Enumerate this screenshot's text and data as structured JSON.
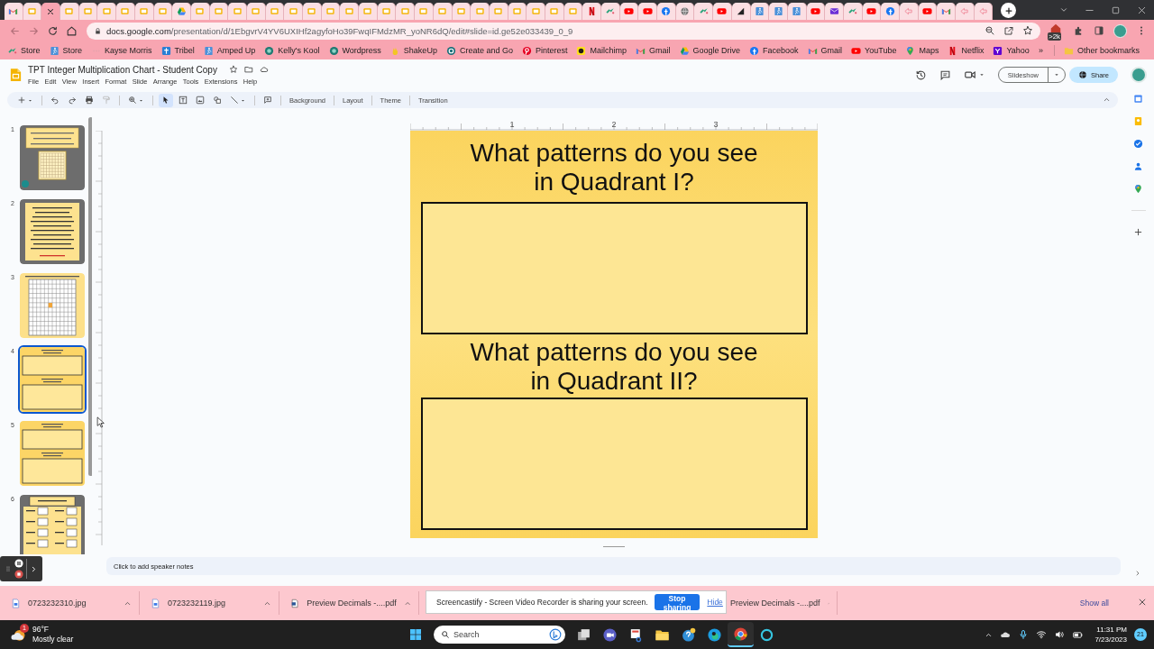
{
  "browser": {
    "tabs": [
      {
        "kind": "gmail",
        "selected": false
      },
      {
        "kind": "slides",
        "selected": false
      },
      {
        "selected": true
      },
      {
        "kind": "slides",
        "selected": false
      },
      {
        "kind": "slides",
        "selected": false
      },
      {
        "kind": "slides",
        "selected": false
      },
      {
        "kind": "slides",
        "selected": false
      },
      {
        "kind": "slides",
        "selected": false
      },
      {
        "kind": "slides",
        "selected": false
      },
      {
        "kind": "drive",
        "selected": false
      },
      {
        "kind": "slides",
        "selected": false
      },
      {
        "kind": "slides",
        "selected": false
      },
      {
        "kind": "slides",
        "selected": false
      },
      {
        "kind": "slides",
        "selected": false
      },
      {
        "kind": "slides",
        "selected": false
      },
      {
        "kind": "slides",
        "selected": false
      },
      {
        "kind": "slides",
        "selected": false
      },
      {
        "kind": "slides",
        "selected": false
      },
      {
        "kind": "slides",
        "selected": false
      },
      {
        "kind": "slides",
        "selected": false
      },
      {
        "kind": "slides",
        "selected": false
      },
      {
        "kind": "slides",
        "selected": false
      },
      {
        "kind": "slides",
        "selected": false
      },
      {
        "kind": "slides",
        "selected": false
      },
      {
        "kind": "slides",
        "selected": false
      },
      {
        "kind": "slides",
        "selected": false
      },
      {
        "kind": "slides",
        "selected": false
      },
      {
        "kind": "slides",
        "selected": false
      },
      {
        "kind": "slides",
        "selected": false
      },
      {
        "kind": "slides",
        "selected": false
      },
      {
        "kind": "slides",
        "selected": false
      },
      {
        "kind": "netflix",
        "selected": false
      },
      {
        "kind": "tribel",
        "selected": false
      },
      {
        "kind": "youtube",
        "selected": false
      },
      {
        "kind": "youtube",
        "selected": false
      },
      {
        "kind": "facebook",
        "selected": false
      },
      {
        "kind": "globe",
        "selected": false
      },
      {
        "kind": "tribel",
        "selected": false
      },
      {
        "kind": "youtube",
        "selected": false
      },
      {
        "kind": "bigcommerce",
        "selected": false
      },
      {
        "kind": "amped",
        "selected": false
      },
      {
        "kind": "amped",
        "selected": false
      },
      {
        "kind": "amped",
        "selected": false
      },
      {
        "kind": "youtube",
        "selected": false
      },
      {
        "kind": "mail",
        "selected": false
      },
      {
        "kind": "tribel",
        "selected": false
      },
      {
        "kind": "youtube",
        "selected": false
      },
      {
        "kind": "facebook",
        "selected": false
      },
      {
        "kind": "cast",
        "selected": false
      },
      {
        "kind": "youtube",
        "selected": false
      },
      {
        "kind": "gmail",
        "selected": false
      },
      {
        "kind": "cast",
        "selected": false
      },
      {
        "kind": "cast",
        "selected": false
      }
    ],
    "url": {
      "host": "docs.google.com",
      "path": "/presentation/d/1EbgvrV4YV6UXIHf2agyfoHo39FwqIFMdzMR_yoNR6dQ/edit#slide=id.ge52e033439_0_9"
    },
    "extension_badge": ">2k",
    "bookmarks": [
      {
        "kind": "tribel",
        "label": "Store"
      },
      {
        "kind": "amped",
        "label": "Store"
      },
      {
        "kind": "blank",
        "label": "Kayse Morris"
      },
      {
        "kind": "cross",
        "label": "Tribel"
      },
      {
        "kind": "amped",
        "label": "Amped Up"
      },
      {
        "kind": "kool",
        "label": "Kelly's Kool"
      },
      {
        "kind": "kool",
        "label": "Wordpress"
      },
      {
        "kind": "hand",
        "label": "ShakeUp"
      },
      {
        "kind": "ring",
        "label": "Create and Go"
      },
      {
        "kind": "pinterest",
        "label": "Pinterest"
      },
      {
        "kind": "mailchimp",
        "label": "Mailchimp"
      },
      {
        "kind": "gmail",
        "label": "Gmail"
      },
      {
        "kind": "drive",
        "label": "Google Drive"
      },
      {
        "kind": "facebook",
        "label": "Facebook"
      },
      {
        "kind": "gmail",
        "label": "Gmail"
      },
      {
        "kind": "youtube",
        "label": "YouTube"
      },
      {
        "kind": "maps",
        "label": "Maps"
      },
      {
        "kind": "netflix",
        "label": "Netflix"
      },
      {
        "kind": "yahoo",
        "label": "Yahoo"
      }
    ],
    "more_bookmarks": "»",
    "other_bookmarks": "Other bookmarks"
  },
  "docs": {
    "title": "TPT Integer Multiplication Chart - Student Copy",
    "menus": [
      "File",
      "Edit",
      "View",
      "Insert",
      "Format",
      "Slide",
      "Arrange",
      "Tools",
      "Extensions",
      "Help"
    ],
    "slideshow": "Slideshow",
    "share": "Share",
    "tools": [
      {
        "kind": "new",
        "selected": false
      },
      {
        "kind": "undo",
        "selected": false
      },
      {
        "kind": "redo",
        "selected": false
      },
      {
        "kind": "print",
        "selected": false
      },
      {
        "kind": "paint-format",
        "selected": false
      },
      {
        "kind": "zoom",
        "selected": false
      },
      {
        "kind": "select",
        "selected": true
      },
      {
        "kind": "text-box",
        "selected": false
      },
      {
        "kind": "image",
        "selected": false
      },
      {
        "kind": "shape",
        "selected": false
      },
      {
        "kind": "line",
        "selected": false
      },
      {
        "kind": "comment",
        "selected": false
      }
    ],
    "toolbar_labels": [
      "Background",
      "Layout",
      "Theme",
      "Transition"
    ],
    "filmstrip": [
      {
        "number": "1",
        "kind": "title",
        "selected": false
      },
      {
        "number": "2",
        "kind": "instructions",
        "selected": false
      },
      {
        "number": "3",
        "kind": "grid",
        "selected": false
      },
      {
        "number": "4",
        "kind": "questions",
        "selected": true
      },
      {
        "number": "5",
        "kind": "questions",
        "selected": false
      },
      {
        "number": "6",
        "kind": "products",
        "selected": false
      }
    ],
    "ruler_labels": [
      "1",
      "2",
      "3"
    ],
    "slide": {
      "questions": [
        "What patterns do you see in Quadrant I?",
        "What patterns do you see in Quadrant II?"
      ]
    },
    "speaker_notes": {
      "placeholder": "Click to add speaker notes"
    }
  },
  "downloads": {
    "items": [
      {
        "kind": "image",
        "name": "0723232310.jpg"
      },
      {
        "kind": "image",
        "name": "0723232119.jpg"
      },
      {
        "kind": "document",
        "name": "Preview Decimals -....pdf"
      },
      {
        "kind": "covered",
        "name": "Preview Decimals -....pdf"
      }
    ],
    "show_all": "Show all",
    "sharing_notice": {
      "message": "Screencastify - Screen Video Recorder is sharing your screen.",
      "stop": "Stop sharing",
      "hide": "Hide"
    }
  },
  "taskbar": {
    "weather": {
      "temperature": "96°F",
      "condition": "Mostly clear",
      "badge": "1"
    },
    "search": {
      "placeholder": "Search"
    },
    "apps": [
      {
        "kind": "task-view",
        "selected": false
      },
      {
        "kind": "video-chat",
        "selected": false
      },
      {
        "kind": "snip",
        "selected": false
      },
      {
        "kind": "folder",
        "selected": false
      },
      {
        "kind": "help",
        "selected": false
      },
      {
        "kind": "edge",
        "selected": false
      },
      {
        "kind": "chrome",
        "selected": true
      },
      {
        "kind": "ring",
        "selected": false
      }
    ],
    "time": "11:31 PM",
    "date": "7/23/2023",
    "notifications": "21"
  }
}
